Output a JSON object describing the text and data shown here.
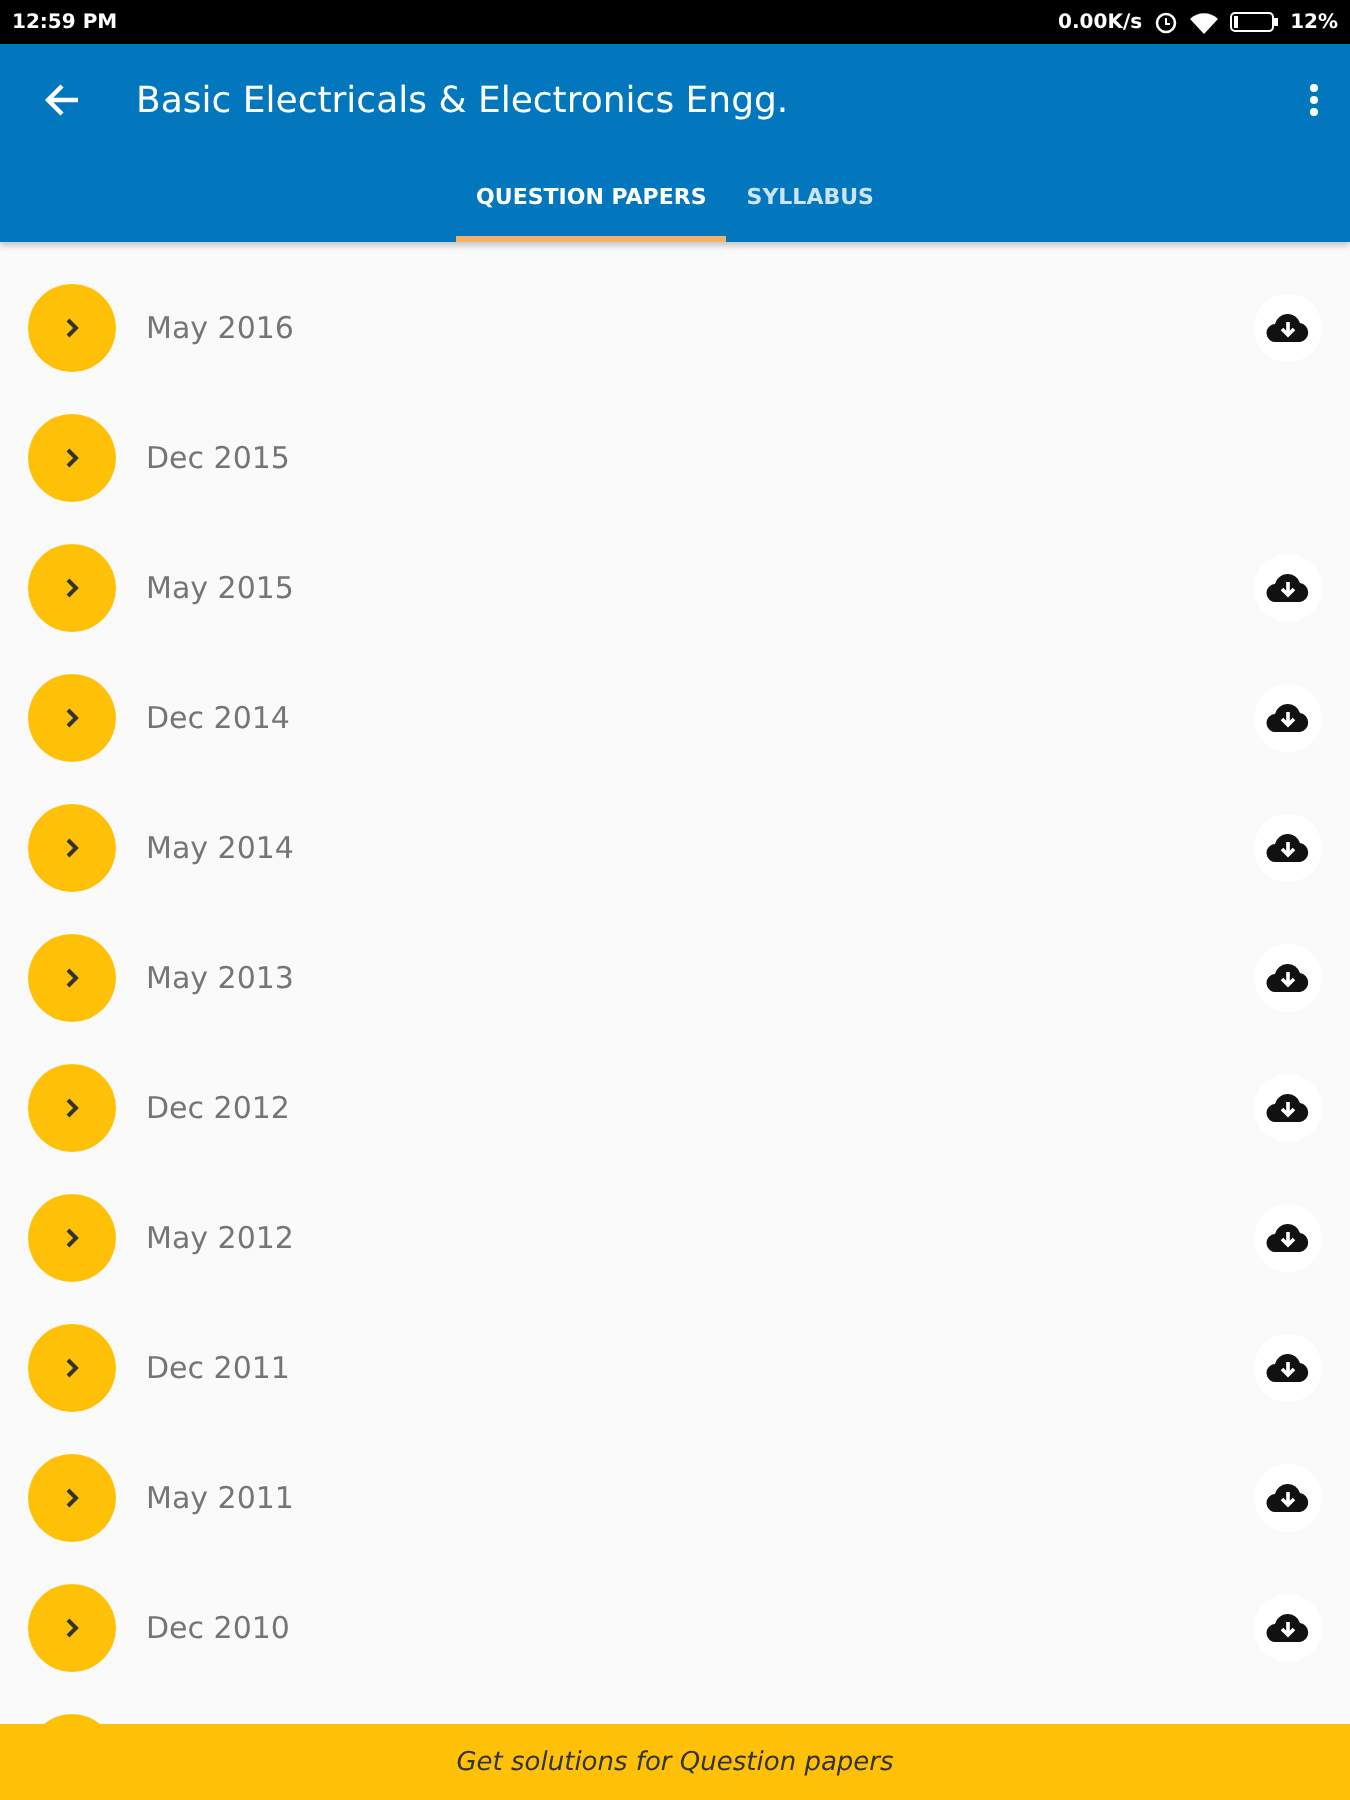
{
  "status_bar": {
    "time": "12:59 PM",
    "speed": "0.00K/s",
    "battery": "12%"
  },
  "app_bar": {
    "title": "Basic Electricals & Electronics Engg."
  },
  "tabs": [
    {
      "label": "QUESTION PAPERS",
      "selected": true
    },
    {
      "label": "SYLLABUS",
      "selected": false
    }
  ],
  "papers": [
    {
      "label": "May 2016",
      "downloadable": true
    },
    {
      "label": "Dec 2015",
      "downloadable": false
    },
    {
      "label": "May 2015",
      "downloadable": true
    },
    {
      "label": "Dec 2014",
      "downloadable": true
    },
    {
      "label": "May 2014",
      "downloadable": true
    },
    {
      "label": "May 2013",
      "downloadable": true
    },
    {
      "label": "Dec 2012",
      "downloadable": true
    },
    {
      "label": "May 2012",
      "downloadable": true
    },
    {
      "label": "Dec 2011",
      "downloadable": true
    },
    {
      "label": "May 2011",
      "downloadable": true
    },
    {
      "label": "Dec 2010",
      "downloadable": true
    }
  ],
  "banner": {
    "text": "Get solutions for Question papers"
  }
}
